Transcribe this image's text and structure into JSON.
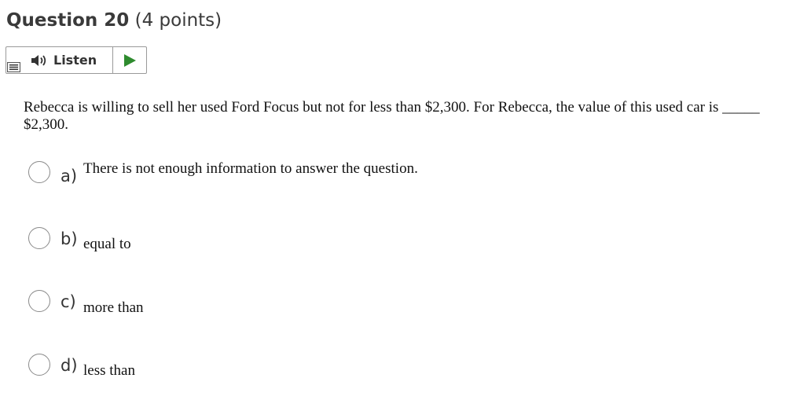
{
  "question": {
    "title": "Question 20",
    "points": "(4 points)",
    "text": "Rebecca is willing to sell her used Ford Focus but not for less than $2,300. For Rebecca, the value of this used car is _____ $2,300."
  },
  "toolbar": {
    "listen_label": "Listen",
    "menu_icon": "menu-icon",
    "speaker_icon": "speaker-icon",
    "play_icon": "play-icon",
    "play_color": "#2e8b2e"
  },
  "options": [
    {
      "letter": "a)",
      "text": "There is not enough information to answer the question."
    },
    {
      "letter": "b)",
      "text": "equal to"
    },
    {
      "letter": "c)",
      "text": "more than"
    },
    {
      "letter": "d)",
      "text": "less than"
    }
  ]
}
